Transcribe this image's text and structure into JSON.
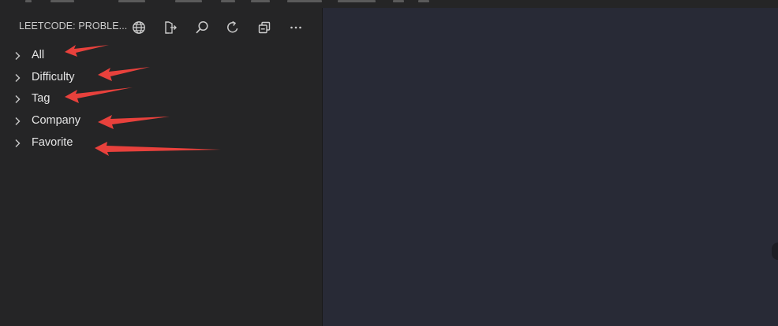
{
  "sidebar": {
    "title": "LEETCODE: PROBLE...",
    "actions": [
      {
        "name": "globe-icon"
      },
      {
        "name": "sign-out-icon"
      },
      {
        "name": "search-icon"
      },
      {
        "name": "refresh-icon"
      },
      {
        "name": "collapse-all-icon"
      },
      {
        "name": "more-icon"
      }
    ],
    "tree": [
      {
        "label": "All"
      },
      {
        "label": "Difficulty"
      },
      {
        "label": "Tag"
      },
      {
        "label": "Company"
      },
      {
        "label": "Favorite"
      }
    ]
  },
  "colors": {
    "sidebar_bg": "#252526",
    "editor_bg": "#282a36",
    "text": "#e6e6e6",
    "annotation_arrow": "#e8413c"
  }
}
